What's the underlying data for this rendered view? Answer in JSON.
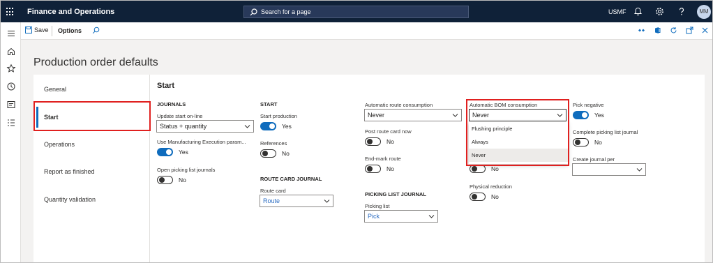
{
  "topbar": {
    "app_title": "Finance and Operations",
    "search_placeholder": "Search for a page",
    "company": "USMF",
    "avatar_initials": "MM"
  },
  "actionbar": {
    "save_label": "Save",
    "options_label": "Options"
  },
  "page": {
    "title": "Production order defaults"
  },
  "tabs": [
    {
      "label": "General"
    },
    {
      "label": "Start",
      "active": true
    },
    {
      "label": "Operations"
    },
    {
      "label": "Report as finished"
    },
    {
      "label": "Quantity validation"
    }
  ],
  "section": {
    "title": "Start"
  },
  "journals": {
    "group": "JOURNALS",
    "update_start_label": "Update start on-line",
    "update_start_value": "Status + quantity",
    "use_mes_label": "Use Manufacturing Execution param...",
    "use_mes_value": "Yes",
    "open_picking_label": "Open picking list journals",
    "open_picking_value": "No"
  },
  "start": {
    "group": "START",
    "start_production_label": "Start production",
    "start_production_value": "Yes",
    "references_label": "References",
    "references_value": "No"
  },
  "route_card_journal": {
    "group": "ROUTE CARD JOURNAL",
    "route_card_label": "Route card",
    "route_card_value": "Route"
  },
  "route": {
    "auto_route_label": "Automatic route consumption",
    "auto_route_value": "Never",
    "post_route_label": "Post route card now",
    "post_route_value": "No",
    "end_mark_label": "End-mark route",
    "end_mark_value": "No"
  },
  "picking_list_journal": {
    "group": "PICKING LIST JOURNAL",
    "picking_list_label": "Picking list",
    "picking_list_value": "Pick"
  },
  "bom": {
    "auto_bom_label": "Automatic BOM consumption",
    "auto_bom_value": "Never",
    "options": [
      "Flushing principle",
      "Always",
      "Never"
    ],
    "hidden_toggle_value": "No",
    "physical_reduction_label": "Physical reduction",
    "physical_reduction_value": "No"
  },
  "picking": {
    "pick_negative_label": "Pick negative",
    "pick_negative_value": "Yes",
    "complete_picking_label": "Complete picking list journal",
    "complete_picking_value": "No",
    "create_journal_label": "Create journal per",
    "create_journal_value": ""
  },
  "colors": {
    "topbar": "#0f2138",
    "accent": "#0f6cbd",
    "highlight": "#e0201f"
  }
}
